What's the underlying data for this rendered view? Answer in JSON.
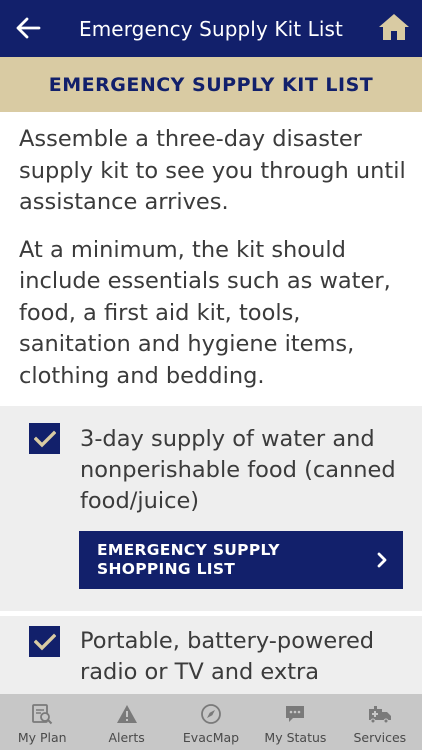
{
  "appbar": {
    "title": "Emergency Supply Kit List",
    "back_icon": "arrow-left-icon",
    "home_icon": "home-icon"
  },
  "banner": {
    "title": "EMERGENCY SUPPLY KIT LIST"
  },
  "intro": {
    "paragraphs": [
      "Assemble a three-day disaster supply kit to see you through until assistance arrives.",
      "At a minimum, the kit should include essentials such as water, food, a first aid kit, tools, sanitation and hygiene items, clothing and bedding."
    ]
  },
  "checklist": {
    "items": [
      {
        "text": "3-day supply of water and nonperishable food (canned food/juice)",
        "checked": true,
        "button_label": "EMERGENCY SUPPLY SHOPPING LIST"
      },
      {
        "text": "Portable, battery-powered radio or TV and extra",
        "checked": true
      }
    ]
  },
  "bottom_nav": {
    "items": [
      {
        "label": "My Plan",
        "icon": "plan-search-icon"
      },
      {
        "label": "Alerts",
        "icon": "alert-icon"
      },
      {
        "label": "EvacMap",
        "icon": "compass-icon"
      },
      {
        "label": "My Status",
        "icon": "chat-status-icon"
      },
      {
        "label": "Services",
        "icon": "ambulance-icon"
      }
    ]
  },
  "colors": {
    "primary_navy": "#12206b",
    "banner_tan": "#d9cba3",
    "item_background": "#eeeeee",
    "nav_background": "#c7c7c7",
    "home_icon_gold": "#d9cba3"
  }
}
